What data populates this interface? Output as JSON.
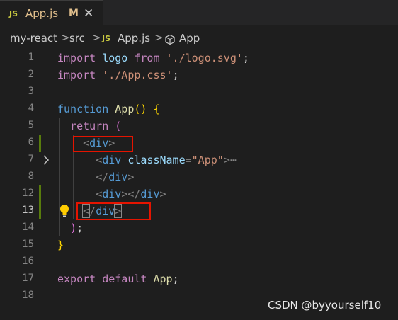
{
  "tab": {
    "badge": "JS",
    "filename": "App.js",
    "modified": "M",
    "close": "✕"
  },
  "breadcrumb": {
    "items": [
      "my-react",
      "src",
      "App.js",
      "App"
    ],
    "separator": ">",
    "badge": "JS",
    "symbol_icon": "cube-icon"
  },
  "editor": {
    "line_numbers": [
      "1",
      "2",
      "3",
      "4",
      "5",
      "6",
      "7",
      "8",
      "12",
      "13",
      "14",
      "15",
      "16",
      "17",
      "18"
    ],
    "active_line": "13",
    "fold_icon": "chevron-right-icon",
    "lightbulb_icon": "lightbulb-icon",
    "tokens": {
      "import": "import",
      "logo": "logo",
      "from": "from",
      "logo_path": "'./logo.svg'",
      "css_path": "'./App.css'",
      "function": "function",
      "app": "App",
      "return": "return",
      "div": "div",
      "classname": "className",
      "classname_value": "\"App\"",
      "ellipsis": "⋯",
      "export": "export",
      "default": "default"
    }
  },
  "watermark": "CSDN @byyourself10",
  "colors": {
    "background": "#1e1e1e",
    "keyword": "#569cd6",
    "control": "#c586c0",
    "string": "#ce9178",
    "function": "#dcdcaa",
    "variable": "#9cdcfe",
    "annotation_box": "#e51400",
    "git_added": "#587c0c"
  }
}
